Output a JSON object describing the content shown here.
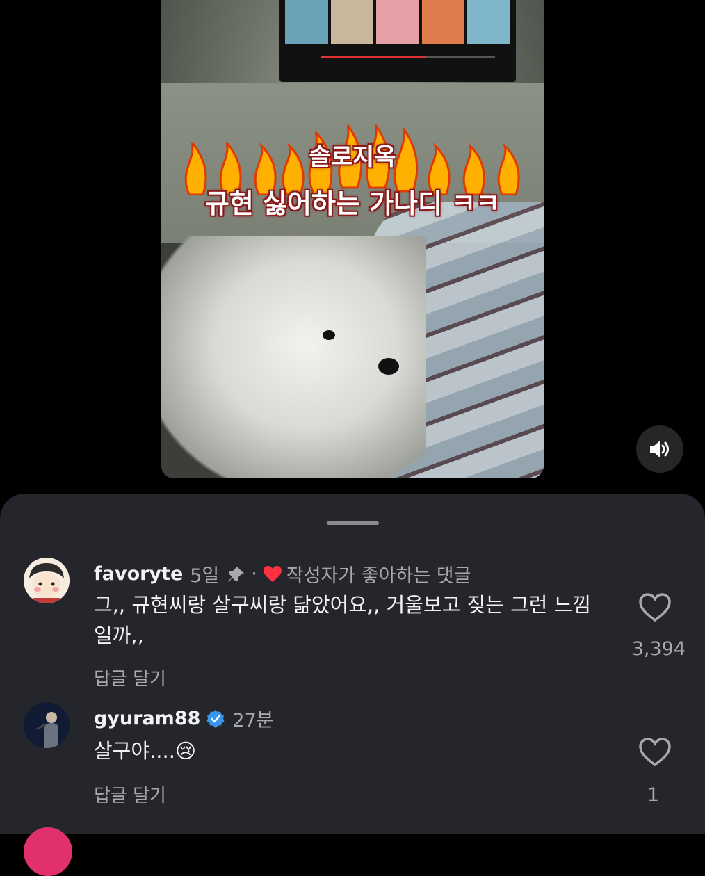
{
  "video": {
    "caption_line1": "솔로지옥",
    "caption_line2": "규현 싫어하는 가나디 ㅋㅋ",
    "sound_icon": "speaker-icon"
  },
  "comments": [
    {
      "username": "favoryte",
      "time": "5일",
      "pinned_icon": "pin-icon",
      "separator": "·",
      "liked_icon": "heart-filled-icon",
      "liked_by_author_text": "작성자가 좋아하는 댓글",
      "text": "그,, 규현씨랑 살구씨랑 닮았어요,, 거울보고 짖는 그런 느낌일까,,",
      "reply_label": "답글 달기",
      "like_count": "3,394"
    },
    {
      "username": "gyuram88",
      "verified_icon": "verified-badge-icon",
      "time": "27분",
      "text": "살구야....😢",
      "reply_label": "답글 달기",
      "like_count": "1"
    }
  ],
  "colors": {
    "sheet_bg": "#25262b",
    "secondary_text": "#a8a8ad",
    "heart_red": "#ff3040",
    "verified_blue": "#3797f0"
  }
}
